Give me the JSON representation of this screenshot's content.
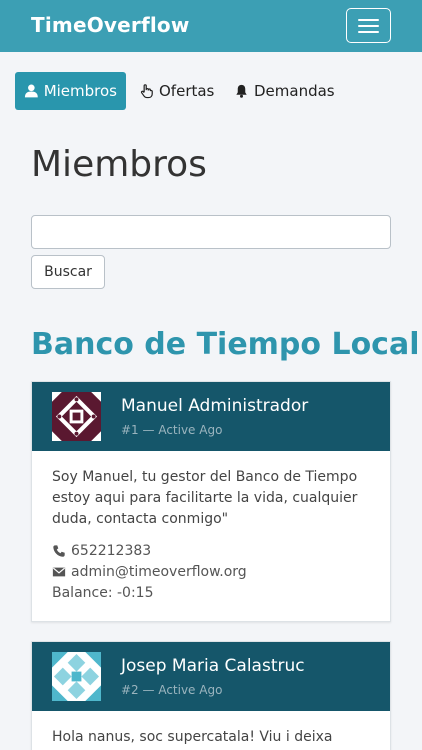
{
  "navbar": {
    "brand": "TimeOverflow"
  },
  "tabs": [
    {
      "label": "Miembros",
      "icon": "user-icon",
      "active": true
    },
    {
      "label": "Ofertas",
      "icon": "hand-pointer-icon",
      "active": false
    },
    {
      "label": "Demandas",
      "icon": "bell-icon",
      "active": false
    }
  ],
  "page": {
    "title": "Miembros"
  },
  "search": {
    "value": "",
    "placeholder": "",
    "button_label": "Buscar"
  },
  "organization": {
    "name": "Banco de Tiempo Local"
  },
  "members": [
    {
      "name": "Manuel Administrador",
      "meta": "#1 — Active Ago",
      "description": "Soy Manuel, tu gestor del Banco de Tiempo estoy aqui para facilitarte la vida, cualquier duda, contacta conmigo\"",
      "phone": "652212383",
      "email": "admin@timeoverflow.org",
      "balance": "Balance: -0:15"
    },
    {
      "name": "Josep Maria Calastruc",
      "meta": "#2 — Active Ago",
      "description": "Hola nanus, soc supercatala! Viu i deixa"
    }
  ],
  "colors": {
    "navbar": "#3c9fb4",
    "tab_active": "#2996ad",
    "card_header": "#15566a",
    "org_title": "#2e95ad"
  }
}
